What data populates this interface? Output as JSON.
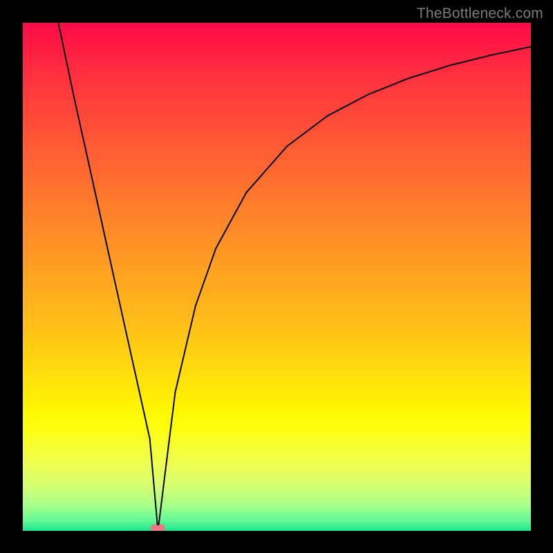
{
  "attribution": "TheBottleneck.com",
  "chart_data": {
    "type": "line",
    "title": "",
    "xlabel": "",
    "ylabel": "",
    "xlim": [
      0,
      100
    ],
    "ylim": [
      0,
      100
    ],
    "grid": false,
    "legend": false,
    "series": [
      {
        "name": "curve",
        "x": [
          7,
          10,
          14,
          18,
          22,
          25,
          26.6,
          28,
          30,
          34,
          38,
          44,
          52,
          60,
          68,
          76,
          84,
          92,
          100
        ],
        "y": [
          100,
          85.7,
          67.7,
          49.6,
          31.6,
          18.1,
          0,
          11.3,
          27.3,
          44.3,
          55.6,
          66.6,
          75.7,
          81.7,
          85.9,
          89.1,
          91.6,
          93.6,
          95.3
        ]
      }
    ],
    "markers": [
      {
        "name": "pink-marker-1",
        "x": 26.0,
        "y": 0.5
      },
      {
        "name": "pink-marker-2",
        "x": 27.2,
        "y": 0.5
      }
    ],
    "background": {
      "type": "vertical-gradient",
      "stops": [
        {
          "pos": 0.0,
          "color": "#ff0b48"
        },
        {
          "pos": 0.5,
          "color": "#ffa81e"
        },
        {
          "pos": 0.78,
          "color": "#fff600"
        },
        {
          "pos": 1.0,
          "color": "#1AE38F"
        }
      ]
    }
  }
}
